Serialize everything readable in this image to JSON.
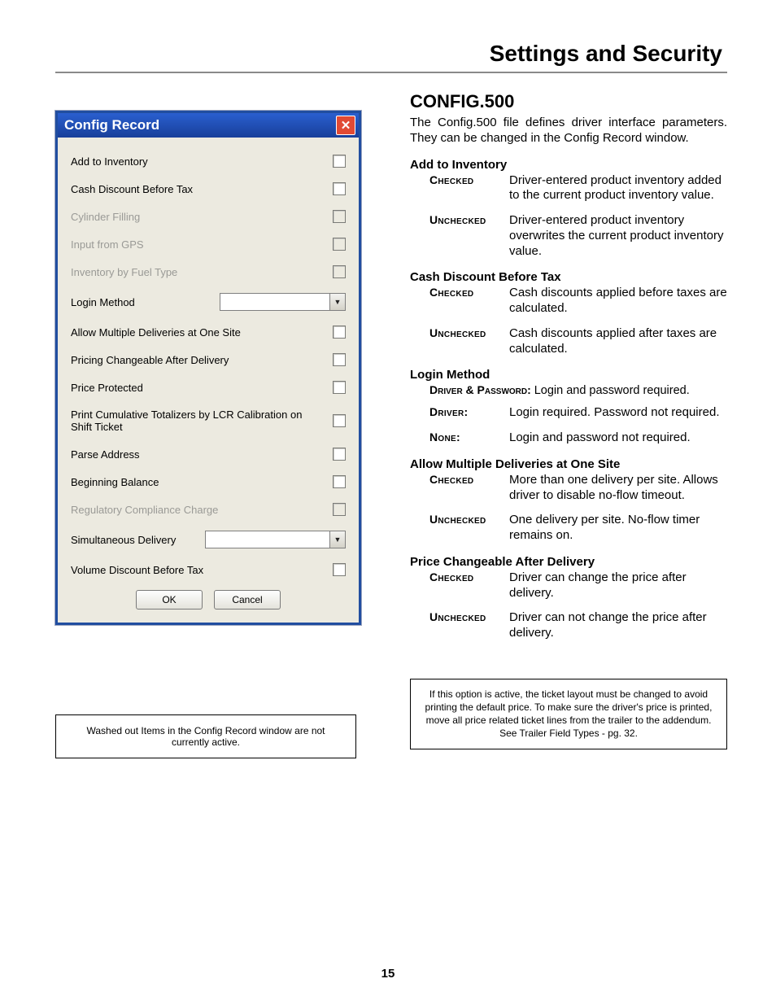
{
  "header": {
    "title": "Settings and Security"
  },
  "dialog": {
    "title": "Config Record",
    "rows": [
      {
        "label": "Add to Inventory",
        "type": "check",
        "disabled": false
      },
      {
        "label": "Cash Discount Before Tax",
        "type": "check",
        "disabled": false
      },
      {
        "label": "Cylinder Filling",
        "type": "check",
        "disabled": true
      },
      {
        "label": "Input from GPS",
        "type": "check",
        "disabled": true
      },
      {
        "label": "Inventory by Fuel Type",
        "type": "check",
        "disabled": true
      },
      {
        "label": "Login Method",
        "type": "combo",
        "disabled": false
      },
      {
        "label": "Allow Multiple Deliveries at One Site",
        "type": "check",
        "disabled": false
      },
      {
        "label": "Pricing Changeable After Delivery",
        "type": "check",
        "disabled": false
      },
      {
        "label": "Price Protected",
        "type": "check",
        "disabled": false
      },
      {
        "label": "Print Cumulative Totalizers by LCR Calibration on Shift Ticket",
        "type": "check",
        "disabled": false
      },
      {
        "label": "Parse Address",
        "type": "check",
        "disabled": false
      },
      {
        "label": "Beginning Balance",
        "type": "check",
        "disabled": false
      },
      {
        "label": "Regulatory Compliance Charge",
        "type": "check",
        "disabled": true
      },
      {
        "label": "Simultaneous Delivery",
        "type": "combo",
        "disabled": false
      },
      {
        "label": "Volume Discount Before Tax",
        "type": "check",
        "disabled": false
      }
    ],
    "ok": "OK",
    "cancel": "Cancel"
  },
  "caption": "Washed out Items in the Config Record window are not currently active.",
  "right": {
    "heading": "CONFIG.500",
    "intro": "The Config.500 file defines driver interface parameters. They can be changed in the Config Record window.",
    "sections": [
      {
        "title": "Add to Inventory",
        "items": [
          {
            "k": "Checked",
            "v": "Driver-entered product inventory added to the current product inventory value."
          },
          {
            "k": "Unchecked",
            "v": "Driver-entered product inventory overwrites the current product inventory value."
          }
        ]
      },
      {
        "title": "Cash Discount Before Tax",
        "items": [
          {
            "k": "Checked",
            "v": "Cash discounts applied before taxes are calculated."
          },
          {
            "k": "Unchecked",
            "v": "Cash discounts applied after taxes are calculated."
          }
        ]
      },
      {
        "title": "Login Method",
        "runin": {
          "k": "Driver & Password:",
          "v": "Login and password required."
        },
        "items": [
          {
            "k": "Driver:",
            "v": "Login required. Password not required."
          },
          {
            "k": "None:",
            "v": "Login and password not required."
          }
        ]
      },
      {
        "title": "Allow Multiple Deliveries at One Site",
        "items": [
          {
            "k": "Checked",
            "v": "More than one delivery per site. Allows driver to disable no-flow timeout."
          },
          {
            "k": "Unchecked",
            "v": "One delivery per site. No-flow timer remains on."
          }
        ]
      },
      {
        "title": "Price Changeable After Delivery",
        "items": [
          {
            "k": "Checked",
            "v": "Driver can change the price after delivery."
          },
          {
            "k": "Unchecked",
            "v": "Driver can not change the price after delivery."
          }
        ]
      }
    ],
    "note": "If this option is active, the ticket layout must be changed to avoid printing the default price. To make sure the driver's price is printed, move all price related ticket lines from the trailer to the addendum. See Trailer Field Types - pg. 32."
  },
  "pagenum": "15"
}
